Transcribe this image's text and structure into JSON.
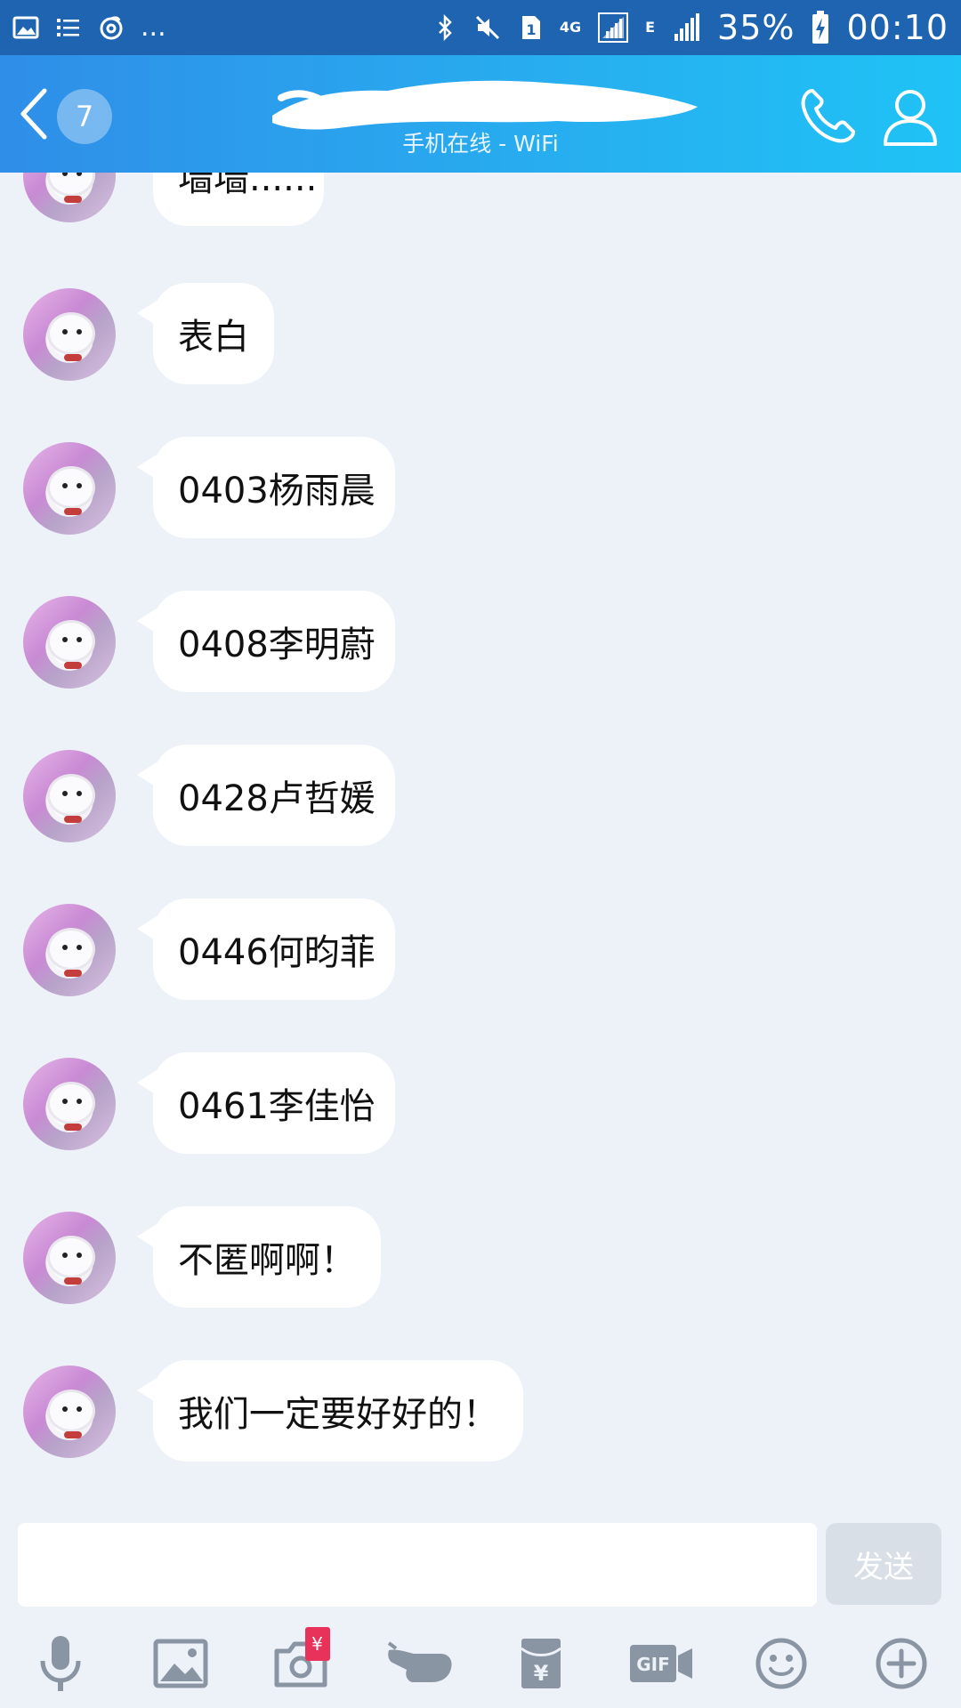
{
  "status_bar": {
    "battery_text": "35%",
    "time": "00:10",
    "sim_slot": "1",
    "network_4g": "4G",
    "network_e": "E",
    "more": "..."
  },
  "header": {
    "unread_count": "7",
    "subtitle": "手机在线 - WiFi"
  },
  "messages": [
    {
      "text": "墙墙......"
    },
    {
      "text": "表白"
    },
    {
      "text": "0403杨雨晨"
    },
    {
      "text": "0408李明蔚"
    },
    {
      "text": "0428卢哲媛"
    },
    {
      "text": "0446何昀菲"
    },
    {
      "text": "0461李佳怡"
    },
    {
      "text": "不匿啊啊！"
    },
    {
      "text": "我们一定要好好的！"
    }
  ],
  "input": {
    "value": "",
    "send_label": "发送"
  },
  "toolbar": {
    "redpacket_symbol": "¥",
    "gif_label": "GIF",
    "items": [
      "voice-icon",
      "image-icon",
      "camera-icon",
      "poke-icon",
      "red-packet-icon",
      "gif-video-icon",
      "emoji-icon",
      "plus-icon"
    ]
  }
}
